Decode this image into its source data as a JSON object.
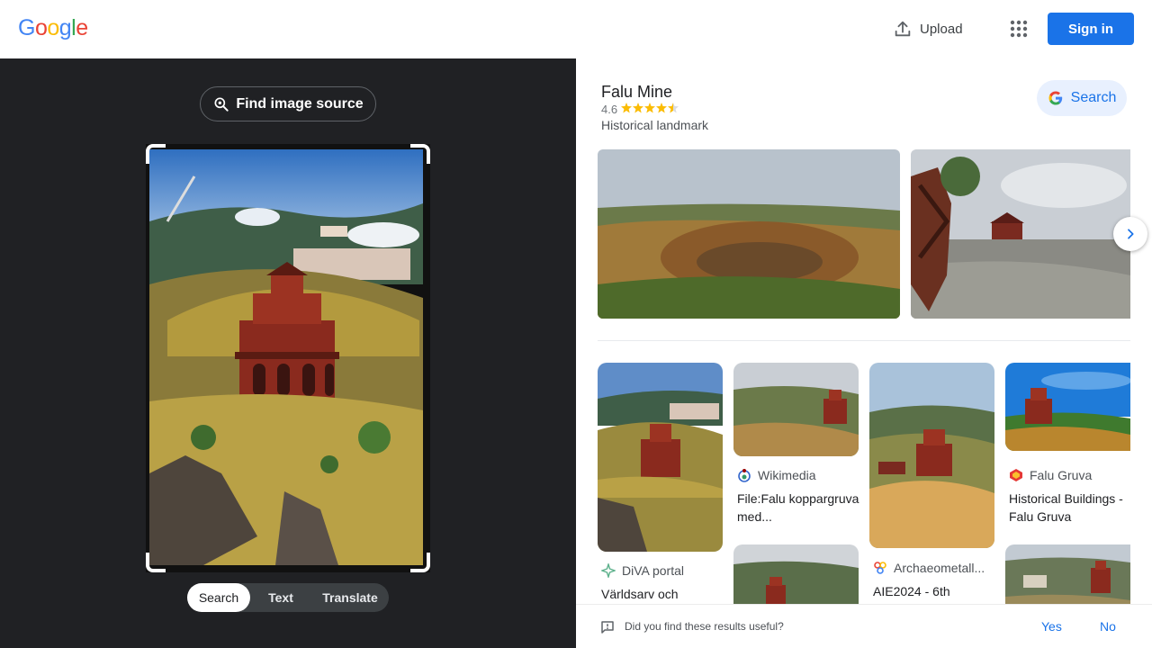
{
  "header": {
    "logo_letters": [
      {
        "ch": "G",
        "color": "#4285f4"
      },
      {
        "ch": "o",
        "color": "#ea4335"
      },
      {
        "ch": "o",
        "color": "#fbbc05"
      },
      {
        "ch": "g",
        "color": "#4285f4"
      },
      {
        "ch": "l",
        "color": "#34a853"
      },
      {
        "ch": "e",
        "color": "#ea4335"
      }
    ],
    "upload_label": "Upload",
    "signin_label": "Sign in"
  },
  "lens": {
    "find_source_label": "Find image source",
    "modes": [
      "Search",
      "Text",
      "Translate"
    ],
    "active_mode": "Search"
  },
  "knowledge_panel": {
    "title": "Falu Mine",
    "rating": "4.6",
    "stars": 4.5,
    "type": "Historical landmark",
    "search_label": "Search"
  },
  "results": [
    {
      "source": "DiVA portal",
      "title": "Världsarv och"
    },
    {
      "source": "Wikimedia",
      "title": "File:Falu koppargruva med..."
    },
    {
      "source": "Archaeometall...",
      "title": "AIE2024 - 6th"
    },
    {
      "source": "Falu Gruva",
      "title": "Historical Buildings - Falu Gruva"
    }
  ],
  "feedback": {
    "question": "Did you find these results useful?",
    "yes": "Yes",
    "no": "No"
  },
  "colors": {
    "accent": "#1a73e8",
    "dark_pane": "#202124",
    "star": "#fbbc04"
  }
}
